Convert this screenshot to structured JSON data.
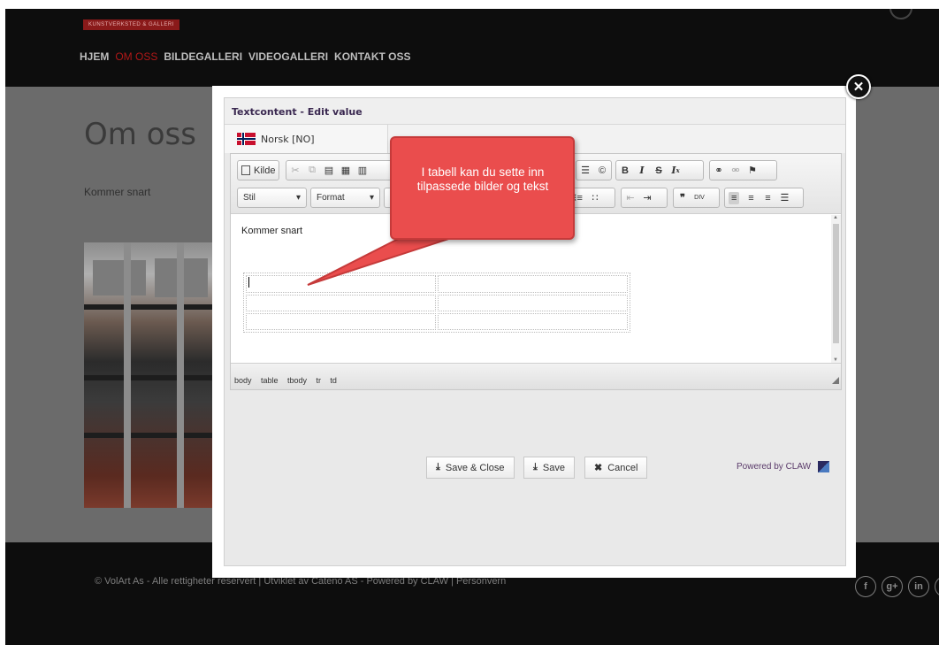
{
  "site": {
    "brand": "KUNSTVERKSTED & GALLERI",
    "nav": [
      "HJEM",
      "OM OSS",
      "BILDEGALLERI",
      "VIDEOGALLERI",
      "KONTAKT OSS"
    ],
    "active_nav": "OM OSS",
    "page_title": "Om oss",
    "page_text": "Kommer snart",
    "footer_text": "© VolArt As - Alle rettigheter reservert | Utviklet av Cateno AS - Powered by CLAW | Personvern",
    "social": [
      "f",
      "g+",
      "in",
      ""
    ]
  },
  "modal": {
    "title": "Textcontent - Edit value",
    "language": "Norsk [NO]",
    "toolbar": {
      "source_label": "Kilde",
      "style_combo": "Stil",
      "format_combo": "Format"
    },
    "editor_text": "Kommer snart",
    "path": [
      "body",
      "table",
      "tbody",
      "tr",
      "td"
    ],
    "buttons": {
      "save_close": "Save & Close",
      "save": "Save",
      "cancel": "Cancel"
    },
    "powered_by": "Powered by CLAW"
  },
  "callout": {
    "text": "I tabell kan du sette inn tilpassede bilder og tekst",
    "color": "#ea4d4d"
  },
  "icons": {
    "close": "close-icon",
    "cut": "cut-icon",
    "copy": "copy-icon",
    "paste": "paste-icon",
    "bold": "B",
    "italic": "I",
    "strike": "S",
    "remove_format": "Ix",
    "link": "link-icon",
    "unlink": "unlink-icon",
    "anchor": "flag-icon",
    "blockquote": "quote-icon",
    "div": "div-icon",
    "align_left": "align-left-icon",
    "align_center": "align-center-icon",
    "align_right": "align-right-icon",
    "justify": "justify-icon"
  }
}
